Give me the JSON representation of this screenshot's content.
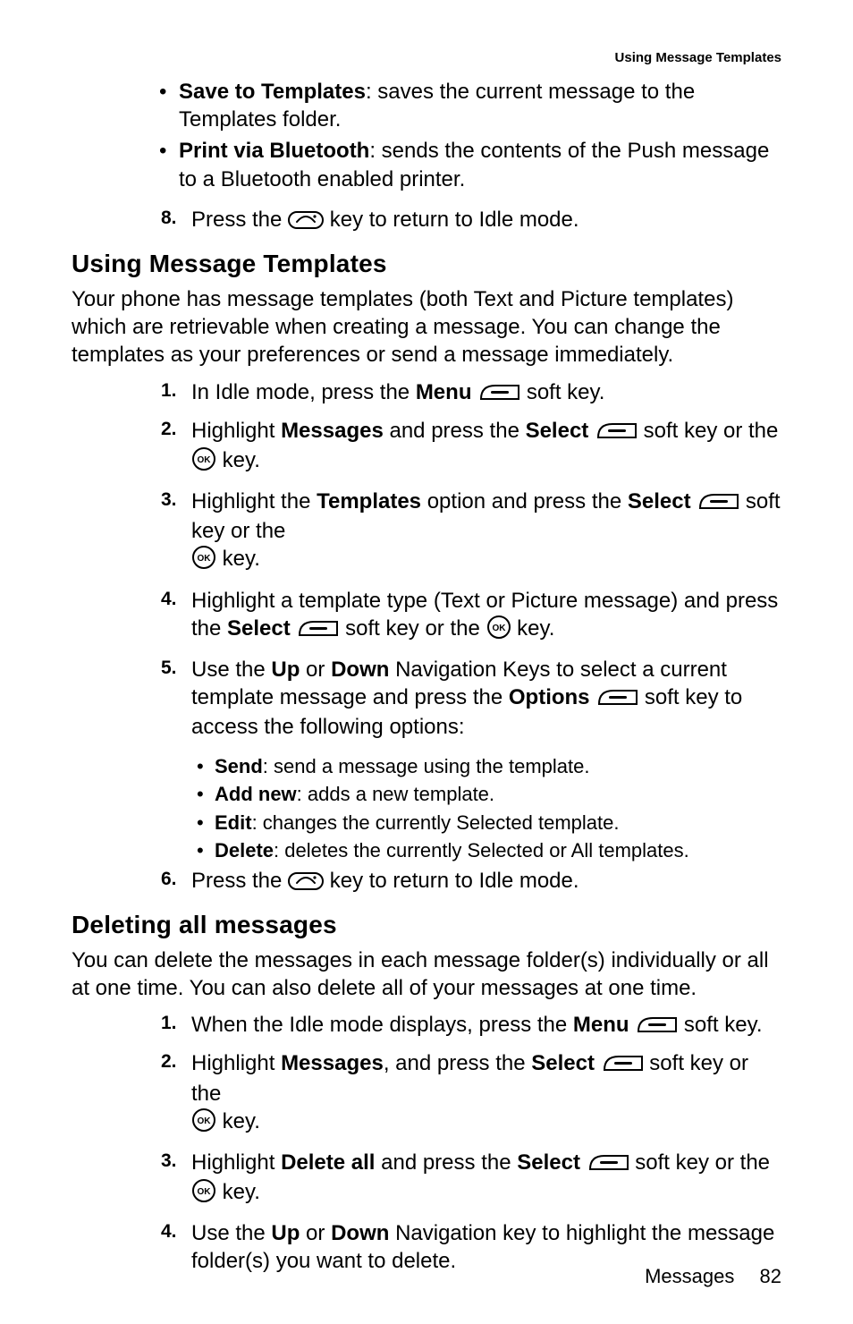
{
  "header": {
    "running": "Using Message Templates"
  },
  "topBullets": [
    {
      "bold": "Save to Templates",
      "rest": ": saves the current message to the Templates folder."
    },
    {
      "bold": "Print via Bluetooth",
      "rest": ":  sends the contents of the Push message to a Bluetooth enabled printer."
    }
  ],
  "step8": {
    "num": "8.",
    "a": "Press the ",
    "b": " key to return to Idle mode."
  },
  "sec1": {
    "title": "Using Message Templates",
    "intro": "Your phone has message templates (both Text and Picture templates) which are retrievable when creating a message. You can change the templates as your preferences or send a message immediately.",
    "s1": {
      "num": "1.",
      "a": "In Idle mode, press the ",
      "menu": "Menu",
      "b": " soft key."
    },
    "s2": {
      "num": "2.",
      "a": "Highlight ",
      "msgs": "Messages",
      "b": " and press the ",
      "sel": "Select",
      "c": " soft key or the ",
      "d": " key."
    },
    "s3": {
      "num": "3.",
      "a": "Highlight the ",
      "tpl": "Templates",
      "b": " option and press the ",
      "sel": "Select",
      "c": " soft key or the ",
      "d": " key."
    },
    "s4": {
      "num": "4.",
      "a": "Highlight a template type (Text or Picture message) and press the ",
      "sel": "Select",
      "b": " soft key or the ",
      "c": " key."
    },
    "s5": {
      "num": "5.",
      "a": "Use the ",
      "up": "Up",
      "or": " or ",
      "dn": "Down",
      "b": " Navigation Keys to select a current template message and press the ",
      "opt": "Options",
      "c": " soft key to access the following options:"
    },
    "s5opts": {
      "send": {
        "b": "Send",
        "r": ": send a message using the template."
      },
      "add": {
        "b": "Add new",
        "r": ": adds a new template."
      },
      "edit": {
        "b": "Edit",
        "r": ": changes the currently Selected template."
      },
      "del": {
        "b": "Delete",
        "r": ": deletes the currently Selected or All templates."
      }
    },
    "s6": {
      "num": "6.",
      "a": "Press the ",
      "b": " key to return to Idle mode."
    }
  },
  "sec2": {
    "title": "Deleting all messages",
    "intro": "You can delete the messages in each message folder(s) individually or all at one time. You can also delete all of your messages at one time.",
    "s1": {
      "num": "1.",
      "a": "When the Idle mode displays, press the ",
      "menu": "Menu",
      "b": " soft key."
    },
    "s2": {
      "num": "2.",
      "a": "Highlight ",
      "msgs": "Messages",
      "b": ", and press the ",
      "sel": "Select",
      "c": " soft key or the ",
      "d": " key."
    },
    "s3": {
      "num": "3.",
      "a": "Highlight ",
      "da": "Delete all",
      "b": " and press the ",
      "sel": "Select",
      "c": " soft key or the ",
      "d": " key."
    },
    "s4": {
      "num": "4.",
      "a": "Use the ",
      "up": "Up",
      "or": " or ",
      "dn": "Down",
      "b": " Navigation key to highlight the message folder(s) you want to delete."
    }
  },
  "footer": {
    "chapter": "Messages",
    "page": "82"
  }
}
